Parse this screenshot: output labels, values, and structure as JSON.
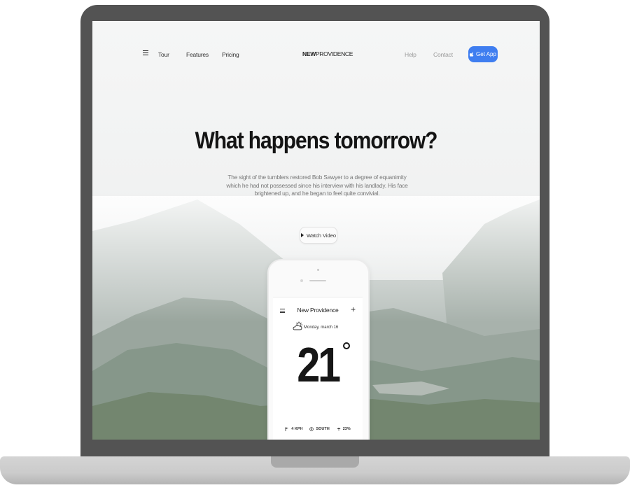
{
  "nav": {
    "items": [
      {
        "label": "Tour"
      },
      {
        "label": "Features"
      },
      {
        "label": "Pricing"
      }
    ],
    "brand_bold": "NEW",
    "brand_rest": "PROVIDENCE",
    "help": "Help",
    "contact": "Contact",
    "cta_label": "Get App"
  },
  "hero": {
    "title": "What happens tomorrow?",
    "text": "The sight of the tumblers restored Bob Sawyer to a degree of equanimity which he had not possessed since his interview with his landlady. His face brightened up, and he began to feel quite convivial.",
    "watch_label": "Watch Video"
  },
  "phone": {
    "title": "New Providence",
    "date": "Monday, march 16",
    "temp": "21",
    "stats": [
      {
        "icon": "flag-icon",
        "value": "4 KPH"
      },
      {
        "icon": "compass-icon",
        "value": "SOUTH"
      },
      {
        "icon": "umbrella-icon",
        "value": "23%"
      }
    ]
  },
  "colors": {
    "accent": "#3f7ef0",
    "bezel": "#535353"
  }
}
